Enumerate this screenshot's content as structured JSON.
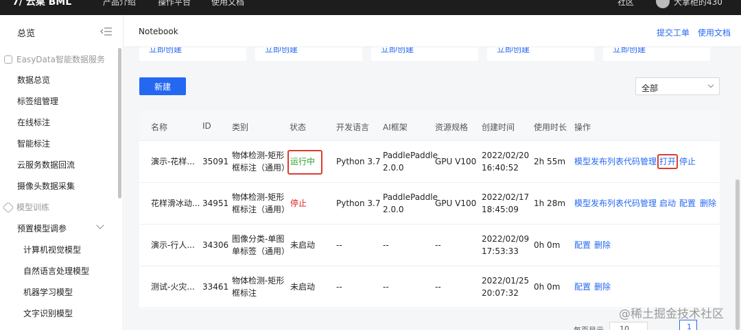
{
  "topbar": {
    "logo": "7/ 云桌 BML",
    "nav": [
      "产品介绍",
      "操作平台",
      "使用文档"
    ],
    "community": "社区",
    "user": "大掌柜的430"
  },
  "sidebar": {
    "title": "总览",
    "group1": "EasyData智能数据服务",
    "items1": [
      "数据总览",
      "标签组管理",
      "在线标注",
      "智能标注",
      "云服务数据回流",
      "摄像头数据采集"
    ],
    "group2": "模型训练",
    "preset": "预置模型调参",
    "subitems": [
      "计算机视觉模型",
      "自然语言处理模型",
      "机器学习模型",
      "文字识别模型"
    ]
  },
  "header": {
    "breadcrumb": "Notebook",
    "ticket": "提交工单",
    "docs": "使用文档"
  },
  "cards": [
    "立即创建",
    "立即创建",
    "立即创建",
    "立即创建",
    "立即创建"
  ],
  "toolbar": {
    "new_label": "新建",
    "filter_value": "全部"
  },
  "table": {
    "columns": [
      "名称",
      "ID",
      "类别",
      "状态",
      "开发语言",
      "AI框架",
      "资源规格",
      "创建时间",
      "使用时长",
      "操作"
    ],
    "rows": [
      {
        "name": "演示-花样...",
        "id": "35091",
        "cat1": "物体检测-矩形",
        "cat2": "框标注（通用）",
        "status": "运行中",
        "lang": "Python 3.7",
        "fw1": "PaddlePaddle",
        "fw2": "2.0.0",
        "res": "GPU V100",
        "d1": "2022/02/20",
        "d2": "16:40:52",
        "dur": "2h 55m",
        "ops": [
          "模型发布列表",
          "代码管理",
          "打开",
          "停止"
        ]
      },
      {
        "name": "花样滑冰动...",
        "id": "34951",
        "cat1": "物体检测-矩形",
        "cat2": "框标注（通用）",
        "status": "停止",
        "lang": "Python 3.7",
        "fw1": "PaddlePaddle",
        "fw2": "2.0.0",
        "res": "GPU V100",
        "d1": "2022/02/17",
        "d2": "18:45:09",
        "dur": "1h 28m",
        "ops": [
          "模型发布列表",
          "代码管理",
          "启动",
          "配置",
          "删除"
        ]
      },
      {
        "name": "演示-行人...",
        "id": "34306",
        "cat1": "图像分类-单图",
        "cat2": "单标签（通用）",
        "status": "未启动",
        "lang": "--",
        "fw1": "--",
        "fw2": "",
        "res": "--",
        "d1": "2022/02/09",
        "d2": "17:53:33",
        "dur": "0h 0m",
        "ops": [
          "配置",
          "删除"
        ]
      },
      {
        "name": "测试-火灾...",
        "id": "33461",
        "cat1": "物体检测-矩形",
        "cat2": "框标注",
        "status": "未启动",
        "lang": "--",
        "fw1": "--",
        "fw2": "",
        "res": "--",
        "d1": "2022/01/25",
        "d2": "20:07:32",
        "dur": "0h 0m",
        "ops": [
          "配置",
          "删除"
        ]
      }
    ]
  },
  "pager": {
    "label": "每页显示",
    "size": "10",
    "page": "1"
  },
  "watermark": "@稀土掘金技术社区",
  "colors": {
    "accent": "#2468f2",
    "running": "#2ca02c",
    "stopped": "#e02020",
    "highlight": "#d93c2c"
  }
}
